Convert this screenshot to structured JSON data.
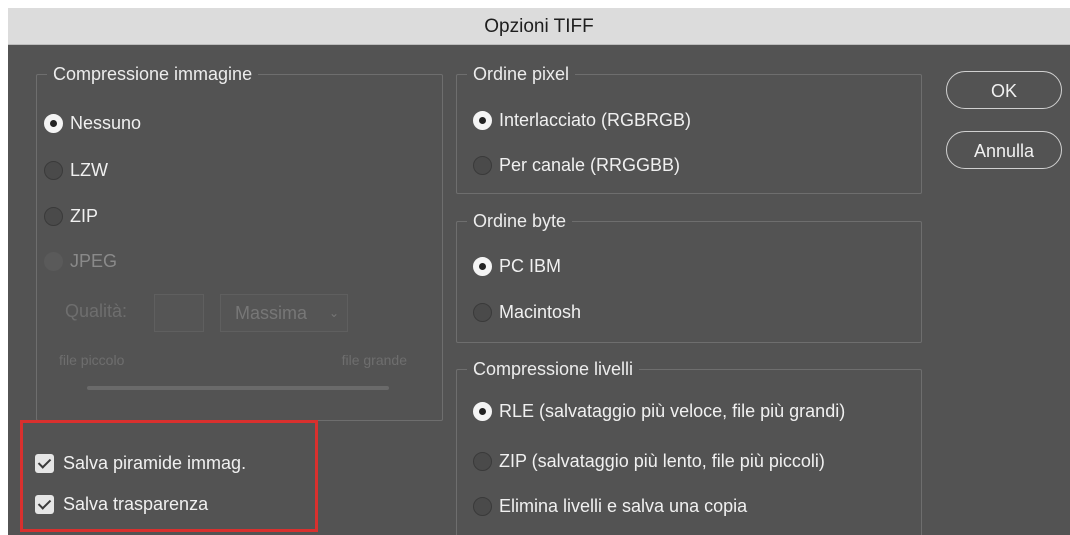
{
  "window": {
    "title": "Opzioni TIFF"
  },
  "image_compression": {
    "legend": "Compressione immagine",
    "options": [
      {
        "label": "Nessuno",
        "selected": true,
        "enabled": true
      },
      {
        "label": "LZW",
        "selected": false,
        "enabled": true
      },
      {
        "label": "ZIP",
        "selected": false,
        "enabled": true
      },
      {
        "label": "JPEG",
        "selected": false,
        "enabled": false
      }
    ],
    "quality_label": "Qualità:",
    "quality_value": "",
    "quality_preset": "Massima",
    "slider_min_label": "file piccolo",
    "slider_max_label": "file grande"
  },
  "pixel_order": {
    "legend": "Ordine pixel",
    "options": [
      {
        "label": "Interlacciato (RGBRGB)",
        "selected": true
      },
      {
        "label": "Per canale (RRGGBB)",
        "selected": false
      }
    ]
  },
  "byte_order": {
    "legend": "Ordine byte",
    "options": [
      {
        "label": "PC IBM",
        "selected": true
      },
      {
        "label": "Macintosh",
        "selected": false
      }
    ]
  },
  "layer_compression": {
    "legend": "Compressione livelli",
    "options": [
      {
        "label": "RLE (salvataggio più veloce, file più grandi)",
        "selected": true
      },
      {
        "label": "ZIP (salvataggio più lento, file più piccoli)",
        "selected": false
      },
      {
        "label": "Elimina livelli e salva una copia",
        "selected": false
      }
    ]
  },
  "checkboxes": [
    {
      "label": "Salva piramide immag.",
      "checked": true
    },
    {
      "label": "Salva trasparenza",
      "checked": true
    }
  ],
  "buttons": {
    "ok": "OK",
    "cancel": "Annulla"
  },
  "colors": {
    "dialog_bg": "#535353",
    "titlebar_bg": "#dcdcdc",
    "highlight": "#d9302e"
  }
}
